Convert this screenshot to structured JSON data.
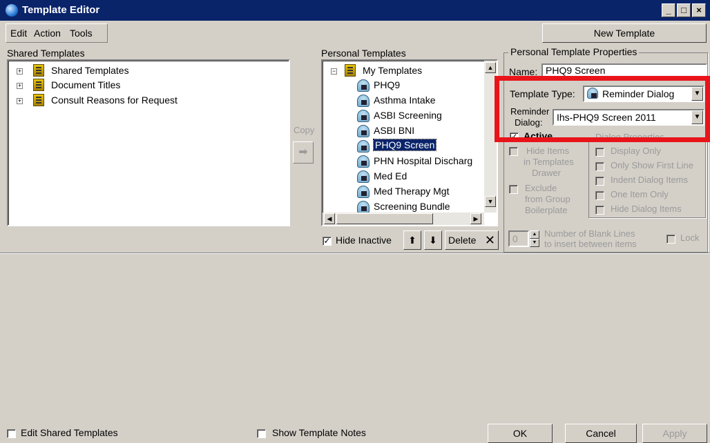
{
  "window": {
    "title": "Template Editor"
  },
  "menu": {
    "edit": "Edit",
    "action": "Action",
    "tools": "Tools"
  },
  "toolbar": {
    "new_template": "New Template"
  },
  "shared": {
    "label": "Shared Templates",
    "items": [
      "Shared Templates",
      "Document Titles",
      "Consult Reasons for Request"
    ]
  },
  "copy": {
    "label": "Copy",
    "arrow": "arrow-right-icon"
  },
  "personal": {
    "label": "Personal Templates",
    "root": "My Templates",
    "items": [
      "PHQ9",
      "Asthma Intake",
      "ASBI Screening",
      "ASBI BNI",
      "PHQ9 Screen",
      "PHN Hospital Discharg",
      "Med Ed",
      "Med Therapy Mgt",
      "Screening Bundle"
    ],
    "selected": "PHQ9 Screen",
    "hide_inactive": "Hide Inactive",
    "delete": "Delete"
  },
  "properties": {
    "group_label": "Personal Template Properties",
    "name_label": "Name:",
    "name_value": "PHQ9 Screen",
    "type_label": "Template Type:",
    "type_value": "Reminder Dialog",
    "reminder_label_1": "Reminder",
    "reminder_label_2": "Dialog:",
    "reminder_value": "Ihs-PHQ9 Screen 2011",
    "active": "Active",
    "hide_items": [
      "Hide Items",
      "in Templates",
      "Drawer"
    ],
    "exclude": [
      "Exclude",
      "from Group",
      "Boilerplate"
    ],
    "dialog_props_label": "Dialog Properties",
    "dialog_props": [
      "Display Only",
      "Only Show First Line",
      "Indent Dialog Items",
      "One Item Only",
      "Hide Dialog Items"
    ],
    "blank_lines_value": "0",
    "blank_lines_label_1": "Number of Blank Lines",
    "blank_lines_label_2": "to insert between items",
    "lock": "Lock"
  },
  "footer": {
    "edit_shared": "Edit Shared Templates",
    "show_notes": "Show Template Notes",
    "ok": "OK",
    "cancel": "Cancel",
    "apply": "Apply"
  },
  "colors": {
    "titlebar": "#0a246a",
    "face": "#d4d0c8",
    "highlight": "#e8141a"
  }
}
